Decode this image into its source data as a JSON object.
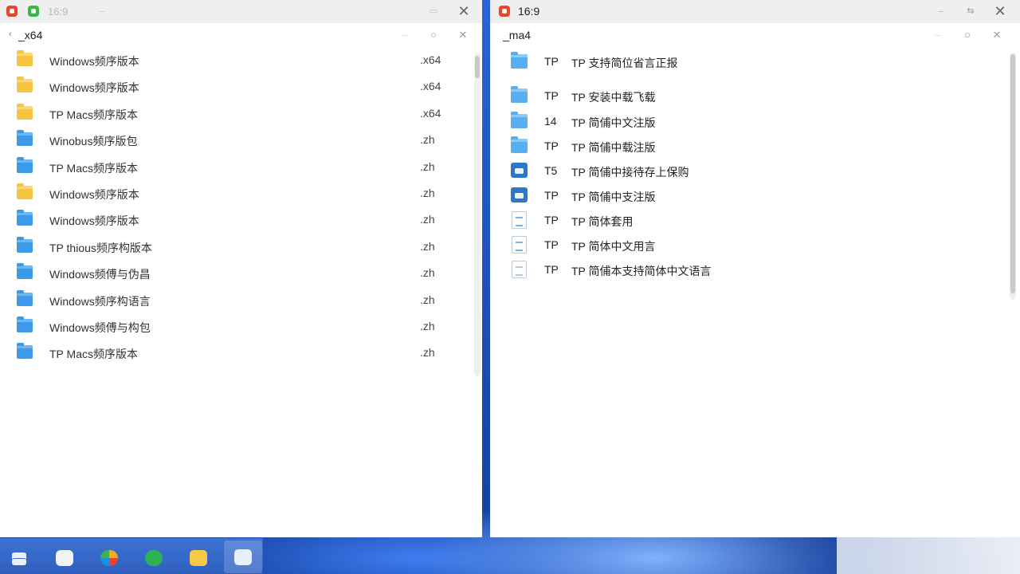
{
  "left_window": {
    "title": "16:9",
    "path": "_x64",
    "items": [
      {
        "name": "Windows频序版本",
        "ext": ".x64",
        "icon": "yellow-folder-icon"
      },
      {
        "name": "Windows频序版本",
        "ext": ".x64",
        "icon": "yellow-folder-icon"
      },
      {
        "name": "TP Macs频序版本",
        "ext": ".x64",
        "icon": "yellow-folder-icon"
      },
      {
        "name": "Winobus频序版包",
        "ext": ".zh",
        "icon": "blue-folder-icon"
      },
      {
        "name": "TP Macs频序版本",
        "ext": ".zh",
        "icon": "blue-folder-icon"
      },
      {
        "name": "Windows频序版本",
        "ext": ".zh",
        "icon": "yellow-folder-icon"
      },
      {
        "name": "Windows频序版本",
        "ext": ".zh",
        "icon": "blue-folder-icon"
      },
      {
        "name": "TP thious频序构版本",
        "ext": ".zh",
        "icon": "blue-folder-icon"
      },
      {
        "name": "Windows频傅与伪昌",
        "ext": ".zh",
        "icon": "blue-folder-icon"
      },
      {
        "name": "Windows频序构语言",
        "ext": ".zh",
        "icon": "blue-folder-icon"
      },
      {
        "name": "Windows频傅与构包",
        "ext": ".zh",
        "icon": "blue-folder-icon"
      },
      {
        "name": "TP Macs频序版本",
        "ext": ".zh",
        "icon": "blue-folder-icon"
      }
    ]
  },
  "right_window": {
    "title": "16:9",
    "path": "_ma4",
    "items": [
      {
        "code": "TP",
        "name": "TP 支持简位省言正报",
        "icon": "folder-icon"
      },
      {
        "code": "TP",
        "name": "TP 安装中载飞载",
        "icon": "folder-icon"
      },
      {
        "code": "14",
        "name": "TP 简俌中文注版",
        "icon": "folder-icon"
      },
      {
        "code": "TP",
        "name": "TP 简俌中载注版",
        "icon": "folder-icon"
      },
      {
        "code": "T5",
        "name": "TP 简俌中接待存上保购",
        "icon": "app-badge-icon"
      },
      {
        "code": "TP",
        "name": "TP 简俌中支注版",
        "icon": "app-badge-icon"
      },
      {
        "code": "TP",
        "name": "TP 简体套用",
        "icon": "document-icon"
      },
      {
        "code": "TP",
        "name": "TP 简体中文用言",
        "icon": "document-icon"
      },
      {
        "code": "TP",
        "name": "TP 简俌本支持简体中文语言",
        "icon": "plain-document-icon"
      }
    ]
  },
  "taskbar": {
    "items": [
      "start-icon",
      "app-icon",
      "photos-icon",
      "maps-icon",
      "file-explorer-icon",
      "messages-icon"
    ],
    "colors": {
      "accent": "#2e5fbf"
    }
  }
}
